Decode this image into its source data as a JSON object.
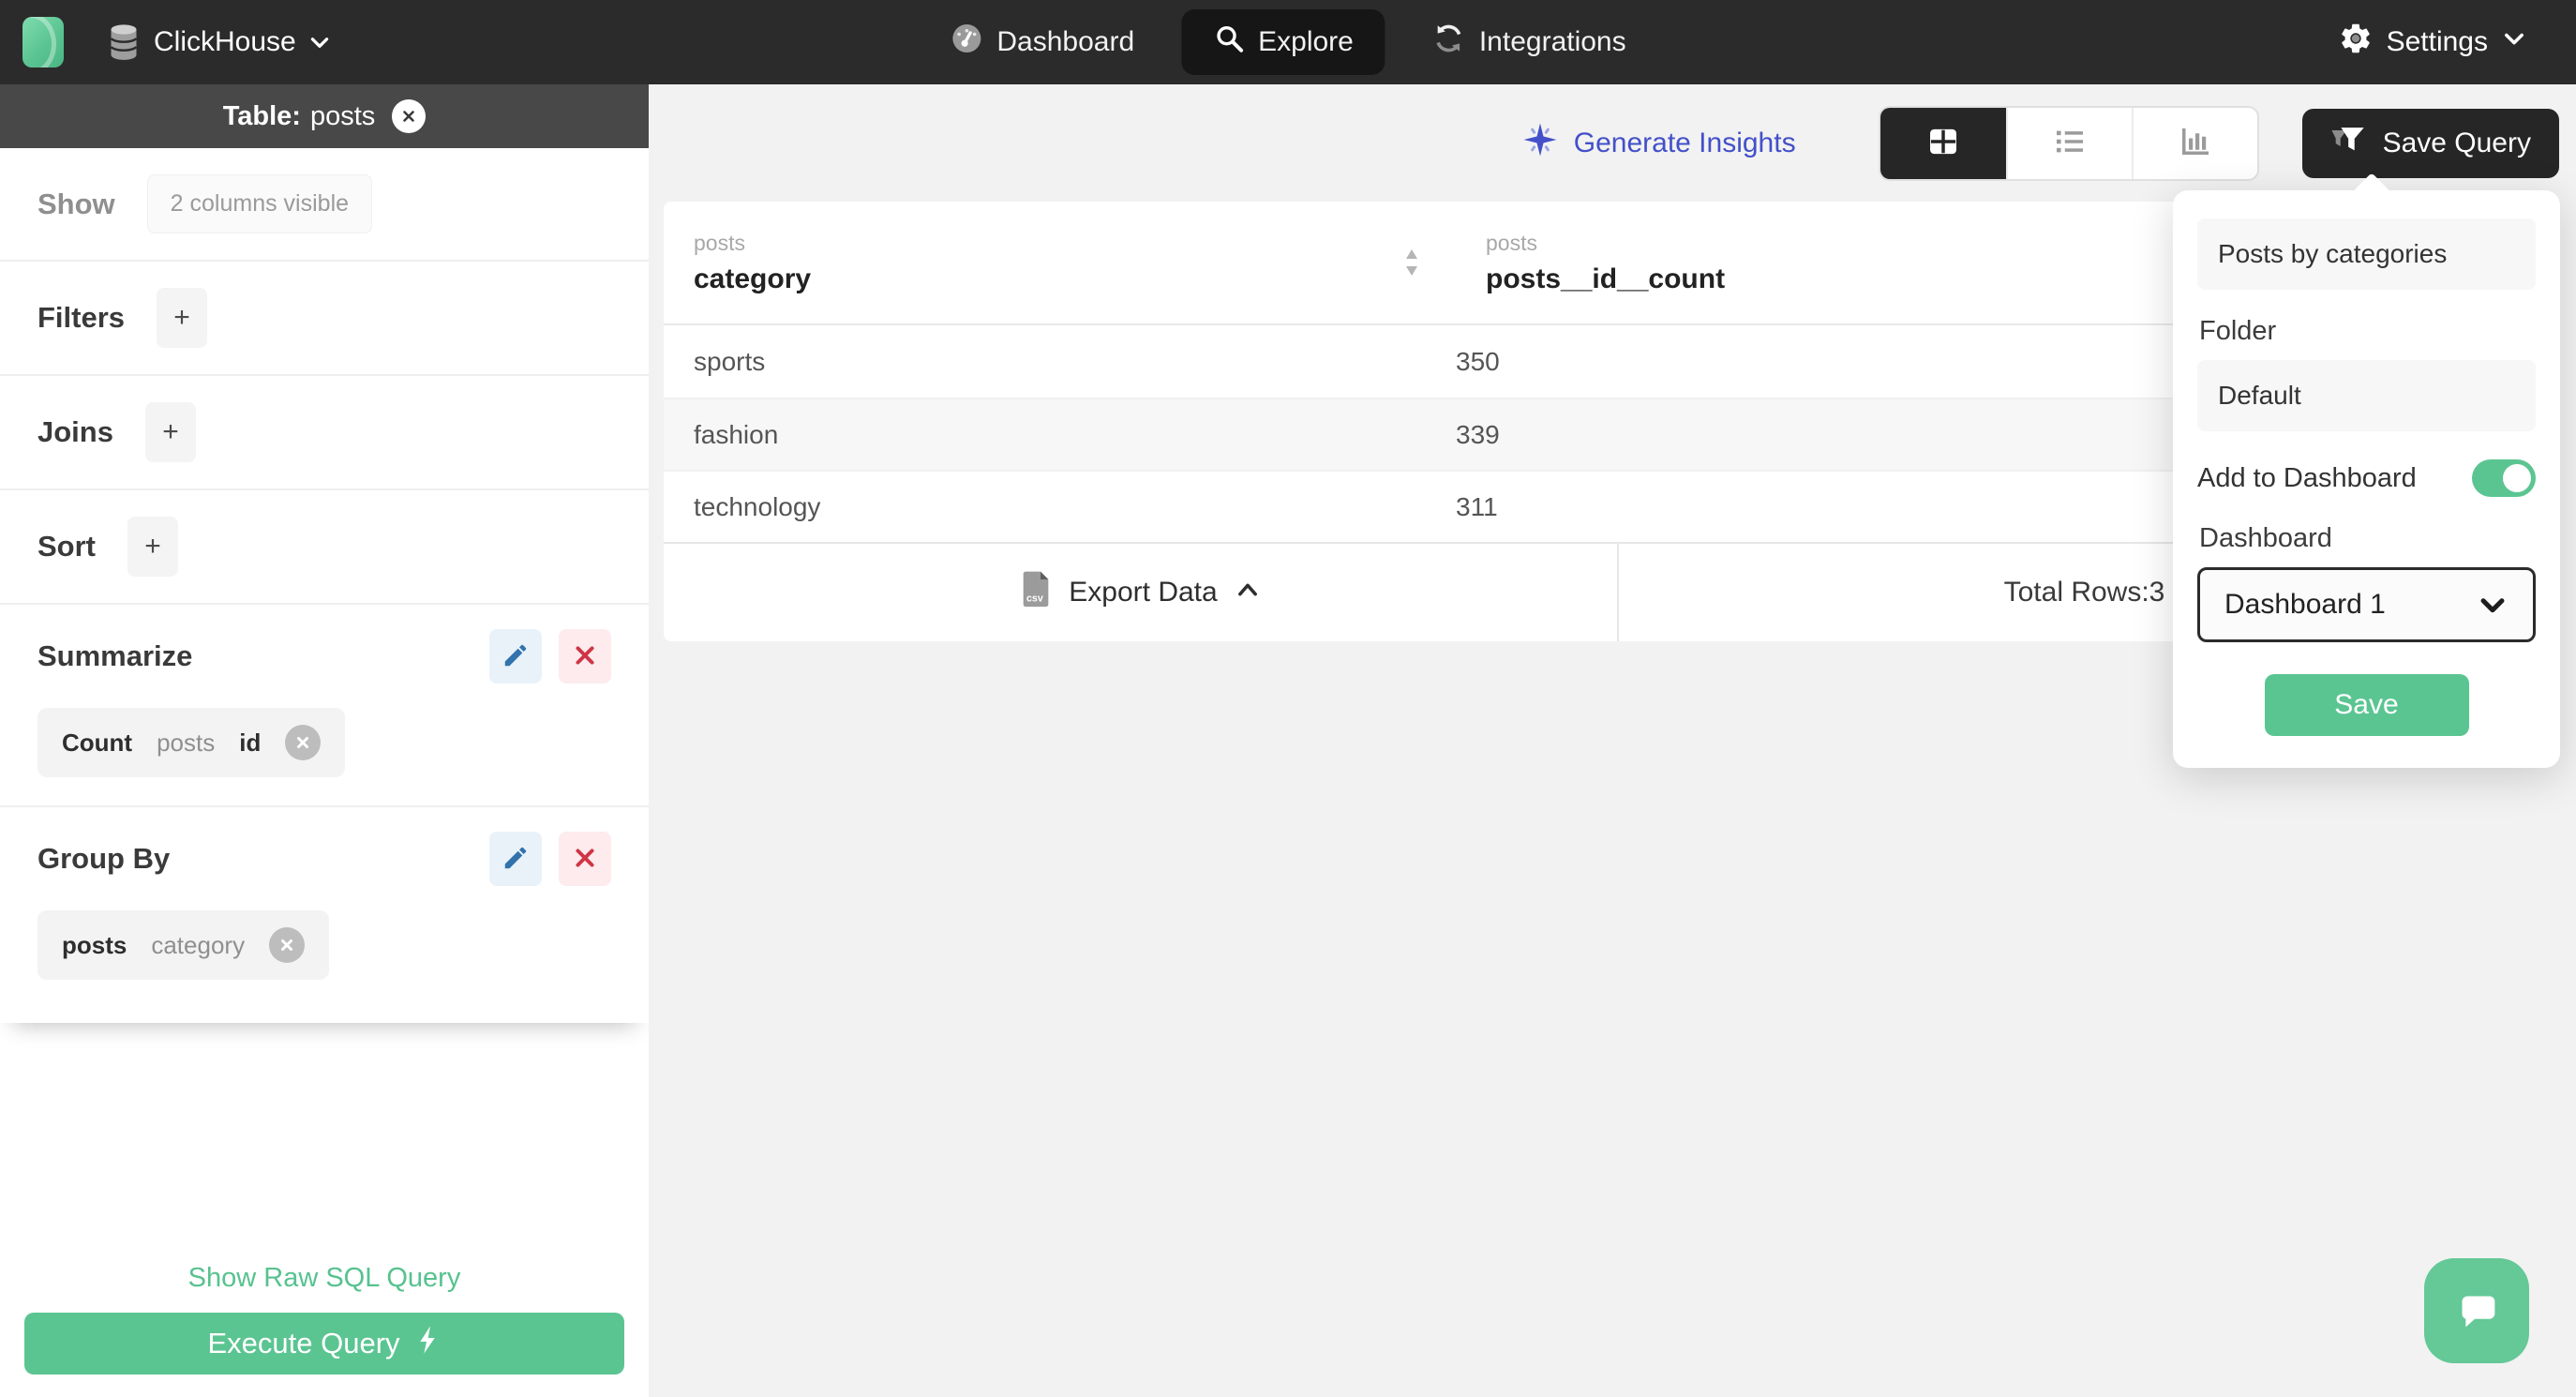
{
  "brand": {
    "name": "ClickHouse"
  },
  "nav": {
    "items": [
      {
        "label": "Dashboard"
      },
      {
        "label": "Explore"
      },
      {
        "label": "Integrations"
      }
    ],
    "settings_label": "Settings"
  },
  "sidebar": {
    "header": {
      "label": "Table:",
      "table": "posts"
    },
    "show": {
      "label": "Show",
      "value": "2 columns visible"
    },
    "sections": [
      {
        "label": "Filters",
        "add_label": "+"
      },
      {
        "label": "Joins",
        "add_label": "+"
      },
      {
        "label": "Sort",
        "add_label": "+"
      }
    ],
    "summarize": {
      "label": "Summarize",
      "chip": {
        "fn": "Count",
        "table": "posts",
        "column": "id"
      }
    },
    "group_by": {
      "label": "Group By",
      "chip": {
        "table": "posts",
        "column": "category"
      }
    },
    "raw_sql_label": "Show Raw SQL Query",
    "execute_label": "Execute Query"
  },
  "toolbar": {
    "insights_label": "Generate Insights",
    "save_query_label": "Save Query"
  },
  "table": {
    "columns": [
      {
        "group": "posts",
        "name": "category"
      },
      {
        "group": "posts",
        "name": "posts__id__count"
      }
    ],
    "rows": [
      {
        "category": "sports",
        "count": "350"
      },
      {
        "category": "fashion",
        "count": "339"
      },
      {
        "category": "technology",
        "count": "311"
      }
    ],
    "footer": {
      "export_label": "Export Data",
      "total_label": "Total Rows:3"
    }
  },
  "popover": {
    "name_value": "Posts by categories",
    "folder_label": "Folder",
    "folder_value": "Default",
    "add_to_dashboard_label": "Add to Dashboard",
    "dashboard_label": "Dashboard",
    "dashboard_value": "Dashboard 1",
    "save_label": "Save"
  },
  "colors": {
    "accent_green": "#5bc592",
    "insights_indigo": "#4350c9",
    "nav_dark": "#2b2b2b",
    "edit_blue": "#3273ad",
    "delete_red": "#cf3545"
  },
  "icons": {
    "database-icon": "cylinder",
    "dashboard-icon": "gauge",
    "search-icon": "magnifier",
    "integrations-icon": "sync-arrows",
    "gear-icon": "gear",
    "chevron-down-icon": "v",
    "chevron-up-icon": "^",
    "close-icon": "x",
    "plus-icon": "+",
    "pencil-icon": "pencil",
    "delete-icon": "x",
    "sparkle-icon": "four-point-star",
    "table-view-icon": "grid",
    "list-view-icon": "list",
    "chart-view-icon": "bars",
    "funnel-icon": "funnel",
    "sort-icon": "up-down-triangles",
    "csv-file-icon": "csv-document",
    "lightning-icon": "bolt",
    "chat-icon": "speech-bubble"
  }
}
